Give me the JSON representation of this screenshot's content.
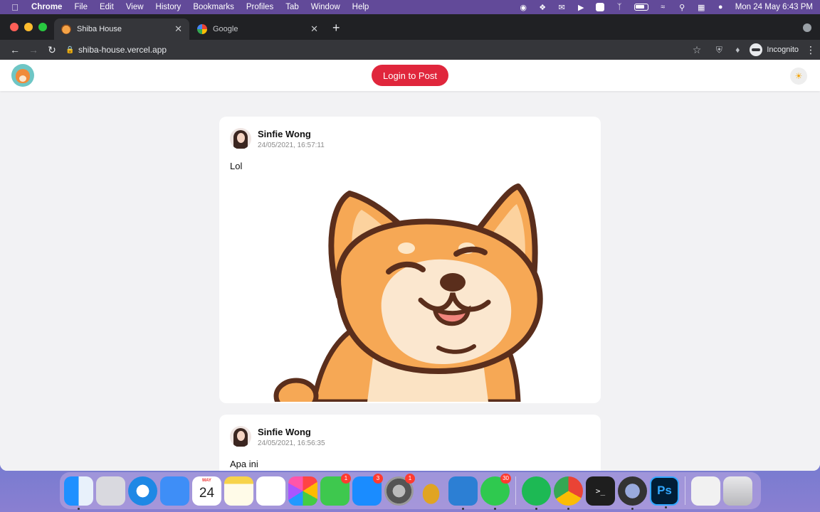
{
  "menubar": {
    "app_name": "Chrome",
    "menus": [
      "File",
      "Edit",
      "View",
      "History",
      "Bookmarks",
      "Profiles",
      "Tab",
      "Window",
      "Help"
    ],
    "clock": "Mon 24 May  6:43 PM",
    "status_icons": [
      "record-icon",
      "dropbox-icon",
      "notification-icon",
      "play-icon",
      "keyboard-a-icon",
      "bluetooth-icon",
      "battery-icon",
      "wifi-icon",
      "search-icon",
      "control-center-icon",
      "siri-icon"
    ]
  },
  "browser": {
    "tabs": [
      {
        "title": "Shiba House",
        "favicon": "shiba-favicon",
        "active": true
      },
      {
        "title": "Google",
        "favicon": "google-favicon",
        "active": false
      }
    ],
    "url": "shiba-house.vercel.app",
    "profile_label": "Incognito"
  },
  "site": {
    "login_label": "Login to Post",
    "accent_color": "#e0263c"
  },
  "posts": [
    {
      "author": "Sinfie Wong",
      "timestamp": "24/05/2021, 16:57:11",
      "text": "Lol",
      "has_image": true
    },
    {
      "author": "Sinfie Wong",
      "timestamp": "24/05/2021, 16:56:35",
      "text": "Apa ini",
      "has_image": false
    }
  ],
  "dock": {
    "apps": [
      {
        "name": "Finder",
        "badge": ""
      },
      {
        "name": "Launchpad",
        "badge": ""
      },
      {
        "name": "Safari",
        "badge": ""
      },
      {
        "name": "Mail",
        "badge": ""
      },
      {
        "name": "Calendar",
        "badge": "",
        "month": "MAY",
        "day": "24"
      },
      {
        "name": "Notes",
        "badge": ""
      },
      {
        "name": "Reminders",
        "badge": ""
      },
      {
        "name": "Photos",
        "badge": ""
      },
      {
        "name": "FaceTime",
        "badge": "1"
      },
      {
        "name": "App Store",
        "badge": "3"
      },
      {
        "name": "System Preferences",
        "badge": "1"
      },
      {
        "name": "Pineapple App",
        "badge": ""
      },
      {
        "name": "Visual Studio Code",
        "badge": ""
      },
      {
        "name": "WhatsApp",
        "badge": "30"
      },
      {
        "name": "Spotify",
        "badge": ""
      },
      {
        "name": "Google Chrome",
        "badge": ""
      },
      {
        "name": "Terminal",
        "badge": "",
        "label": ">_"
      },
      {
        "name": "QuickTime",
        "badge": ""
      },
      {
        "name": "Photoshop",
        "badge": "",
        "label": "Ps"
      },
      {
        "name": "Documents",
        "badge": ""
      },
      {
        "name": "Trash",
        "badge": ""
      }
    ]
  }
}
